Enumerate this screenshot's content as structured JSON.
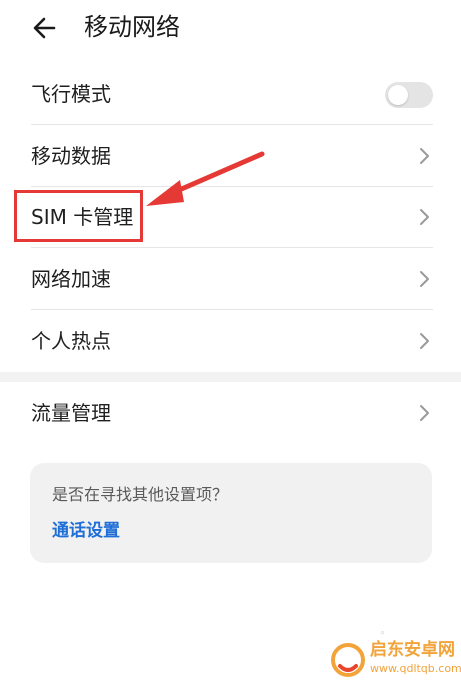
{
  "header": {
    "back_icon": "arrow-left-icon",
    "title": "移动网络"
  },
  "settings": {
    "items": [
      {
        "label": "飞行模式",
        "control": "toggle",
        "toggle_on": false
      },
      {
        "label": "移动数据",
        "control": "chevron"
      },
      {
        "label": "SIM 卡管理",
        "control": "chevron",
        "highlighted": true
      },
      {
        "label": "网络加速",
        "control": "chevron"
      },
      {
        "label": "个人热点",
        "control": "chevron"
      }
    ],
    "section2": [
      {
        "label": "流量管理",
        "control": "chevron"
      }
    ]
  },
  "suggestion": {
    "question": "是否在寻找其他设置项？",
    "link": "通话设置"
  },
  "annotation": {
    "color": "#e53935",
    "shape": "red-rectangle-with-arrow"
  },
  "watermark": {
    "name": "启东安卓网",
    "url": "www.qdltqb.com",
    "color": "#f2a33a"
  },
  "colors": {
    "link": "#1f6fd6",
    "toggle_off": "#e4e4e4",
    "section_gap": "#f2f2f2",
    "card_bg": "#f1f1f1"
  }
}
